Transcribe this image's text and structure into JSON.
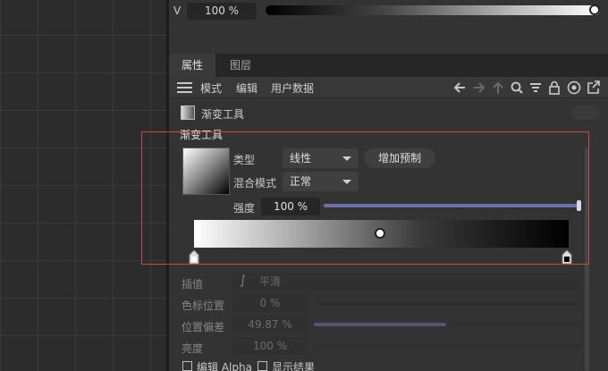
{
  "top": {
    "v_label": "V",
    "v_value": "100 %",
    "v_level": 1.0
  },
  "tabs": [
    {
      "label": "属性"
    },
    {
      "label": "图层"
    }
  ],
  "toolbar": {
    "items": [
      "模式",
      "编辑",
      "用户数据"
    ]
  },
  "object": {
    "title": "渐变工具"
  },
  "section": {
    "title": "渐变工具",
    "type_label": "类型",
    "type_value": "线性",
    "add_preset": "增加预制",
    "blend_label": "混合模式",
    "blend_value": "正常",
    "strength_label": "强度",
    "strength_value": "100 %",
    "strength_level": 1.0
  },
  "lower": {
    "interp_label": "插值",
    "interp_value": "平滑",
    "stop_pos_label": "色标位置",
    "stop_pos_value": "0 %",
    "pos_offset_label": "位置偏差",
    "pos_offset_value": "49.87 %",
    "brightness_label": "亮度",
    "brightness_value": "100 %",
    "edit_alpha": "编辑 Alpha",
    "show_result": "显示结果"
  },
  "colors": {
    "accent": "#6f6fa8",
    "highlight_box": "#c94a4a",
    "panel_bg": "#333333"
  }
}
